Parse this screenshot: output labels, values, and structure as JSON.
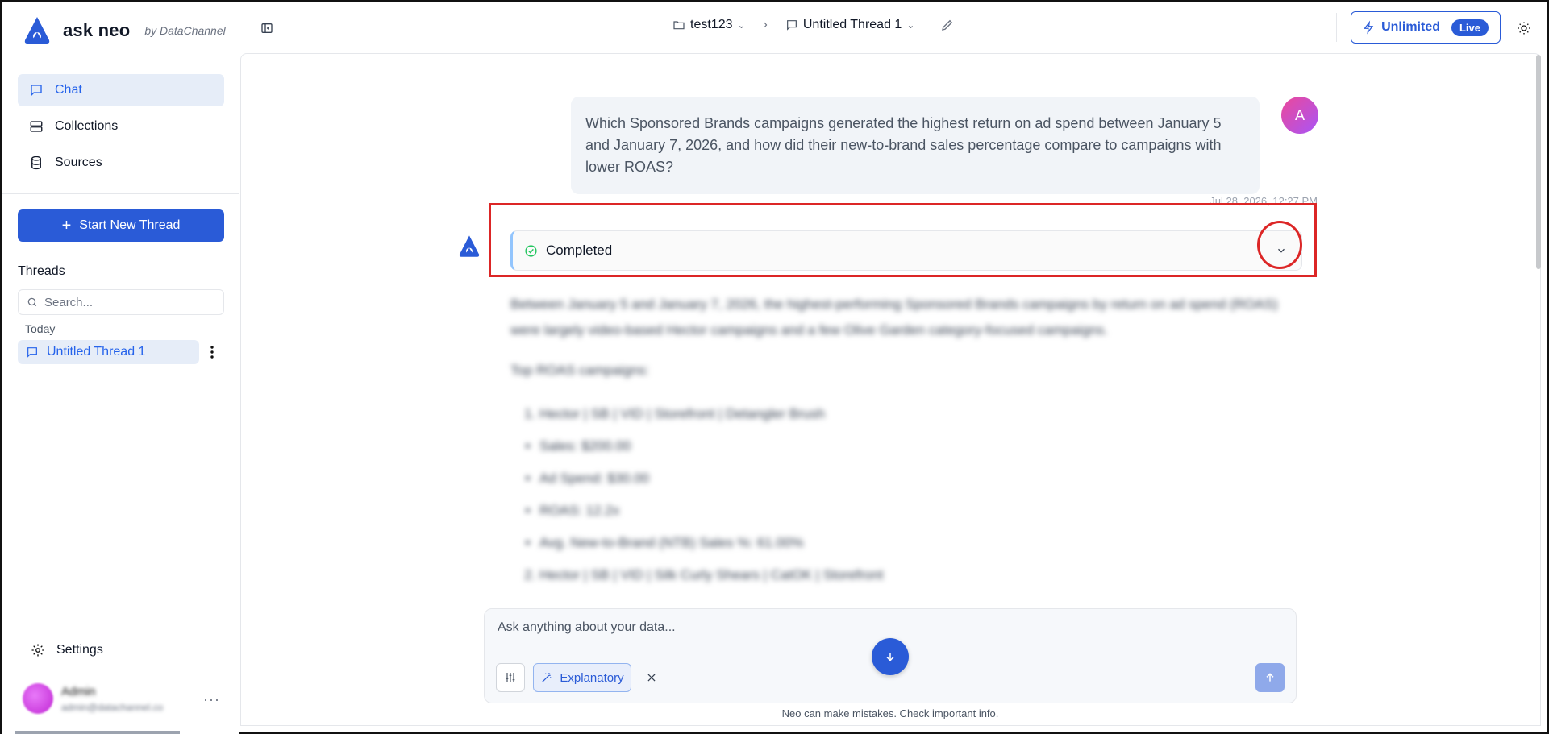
{
  "brand": {
    "name": "ask neo",
    "by": "by DataChannel"
  },
  "sidebar": {
    "nav": [
      {
        "label": "Chat",
        "icon": "chat-icon",
        "active": true
      },
      {
        "label": "Collections",
        "icon": "collections-icon",
        "active": false
      },
      {
        "label": "Sources",
        "icon": "database-icon",
        "active": false
      }
    ],
    "new_thread_label": "Start New Thread",
    "threads_label": "Threads",
    "search_placeholder": "Search...",
    "group_today": "Today",
    "thread_item": "Untitled Thread 1",
    "settings_label": "Settings",
    "user": {
      "name": "Admin",
      "email": "admin@datachannel.co"
    }
  },
  "header": {
    "project": "test123",
    "thread": "Untitled Thread 1",
    "plan_label": "Unlimited",
    "plan_badge": "Live"
  },
  "conversation": {
    "user_avatar_initial": "A",
    "user_message": "Which Sponsored Brands campaigns generated the highest return on ad spend between January 5 and January 7, 2026, and how did their new-to-brand sales percentage compare to campaigns with lower ROAS?",
    "timestamp": "Jul 28, 2026, 12:27 PM",
    "status": "Completed",
    "answer": {
      "intro": "Between January 5 and January 7, 2026, the highest-performing Sponsored Brands campaigns by return on ad spend (ROAS) were largely video-based Hector campaigns and a few Olive Garden category-focused campaigns.",
      "heading": "Top ROAS campaigns:",
      "item1": "Hector | SB | VID | Storefront | Detangler Brush",
      "bullets": [
        "Sales: $200.00",
        "Ad Spend: $30.00",
        "ROAS: 12.2x",
        "Avg. New-to-Brand (NTB) Sales %: 61.00%"
      ],
      "item2": "Hector | SB | VID | Silk Curly Shears | CatOK | Storefront"
    }
  },
  "composer": {
    "placeholder": "Ask anything about your data...",
    "mode_label": "Explanatory",
    "disclaimer": "Neo can make mistakes. Check important info."
  },
  "colors": {
    "accent": "#2a5bd7",
    "annotation": "#dc2626",
    "success": "#22c55e"
  }
}
